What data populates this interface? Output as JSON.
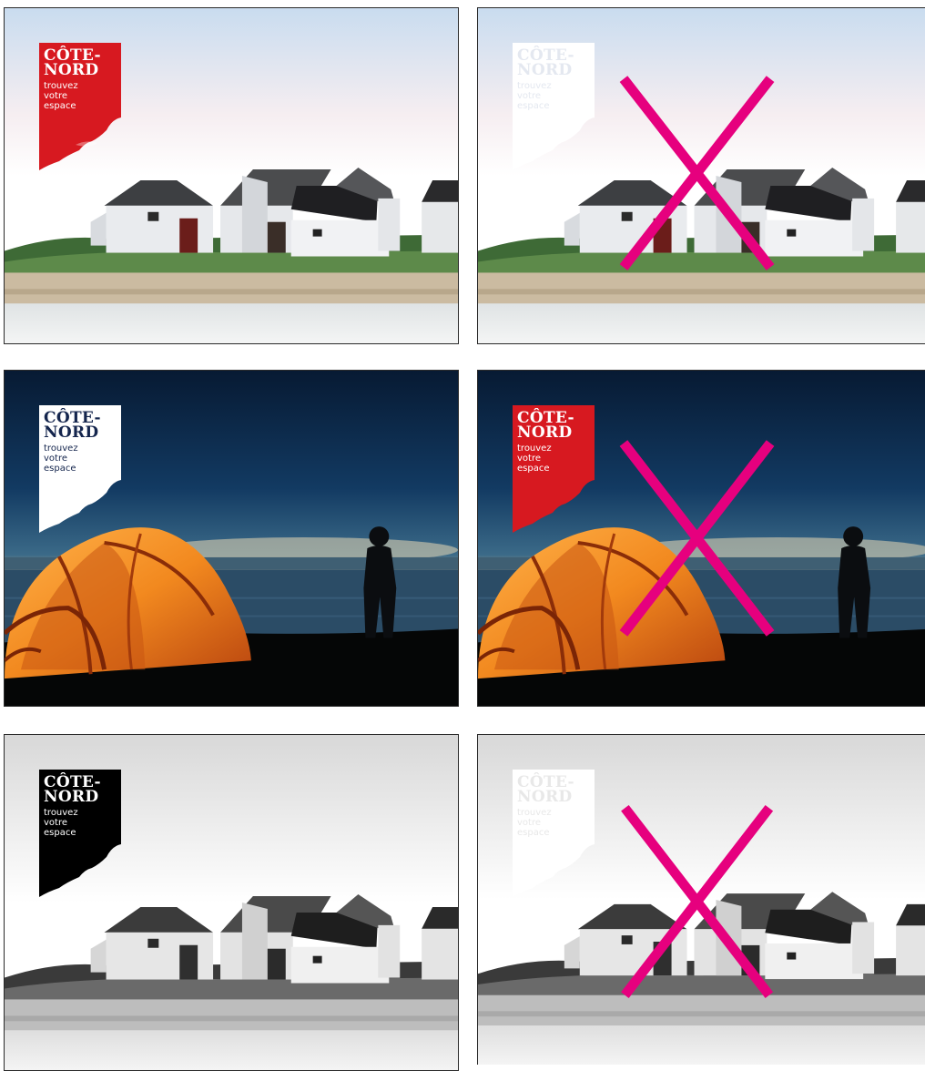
{
  "logo": {
    "line1": "CÔTE-",
    "line2": "NORD",
    "tagline": [
      "trouvez",
      "votre",
      "espace"
    ]
  },
  "colors": {
    "brand_red": "#d71920",
    "navy": "#14254d",
    "black": "#000000",
    "white": "#ffffff",
    "x_mark": "#e6007e"
  },
  "panels": [
    {
      "id": "cabins-red",
      "scene": "cabins-color",
      "logo_bg": "#d71920",
      "logo_fg": "#ffffff",
      "crossed": false
    },
    {
      "id": "cabins-white-faded",
      "scene": "cabins-color",
      "logo_bg": "#ffffff",
      "logo_fg": "#e4e8f0",
      "crossed": true
    },
    {
      "id": "tent-white",
      "scene": "tent-night",
      "logo_bg": "#ffffff",
      "logo_fg": "#14254d",
      "crossed": false
    },
    {
      "id": "tent-red",
      "scene": "tent-night",
      "logo_bg": "#d71920",
      "logo_fg": "#ffffff",
      "crossed": true
    },
    {
      "id": "cabins-bw-black",
      "scene": "cabins-bw",
      "logo_bg": "#000000",
      "logo_fg": "#ffffff",
      "crossed": false
    },
    {
      "id": "cabins-bw-white",
      "scene": "cabins-bw",
      "logo_bg": "#ffffff",
      "logo_fg": "#e8e8e8",
      "crossed": true
    }
  ]
}
